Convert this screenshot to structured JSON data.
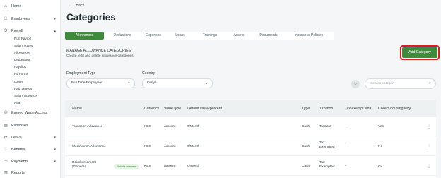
{
  "sidebar": {
    "top_items": [
      {
        "icon": "home-icon",
        "glyph": "⌂",
        "label": "Home"
      },
      {
        "icon": "employees-icon",
        "glyph": "⚇",
        "label": "Employees"
      },
      {
        "icon": "payroll-icon",
        "glyph": "$",
        "label": "Payroll"
      }
    ],
    "payroll_sub": [
      "Run Payroll",
      "Salary Rates",
      "Allowances",
      "Deductions",
      "Payslips",
      "P9 Forms",
      "Loans",
      "Paid Leaves",
      "Salary Advance",
      "Nita"
    ],
    "bottom_items": [
      {
        "icon": "earned-wage-icon",
        "glyph": "⛁",
        "label": "Earned Wage Access"
      },
      {
        "icon": "expenses-icon",
        "glyph": "▤",
        "label": "Expenses"
      },
      {
        "icon": "leave-icon",
        "glyph": "⇄",
        "label": "Leave"
      },
      {
        "icon": "benefits-icon",
        "glyph": "♡",
        "label": "Benefits"
      },
      {
        "icon": "payments-icon",
        "glyph": "▭",
        "label": "Payments"
      },
      {
        "icon": "reports-icon",
        "glyph": "▥",
        "label": "Reports"
      }
    ]
  },
  "header": {
    "back_label": "Back",
    "title": "Categories"
  },
  "tabs": [
    "Allowances",
    "Deductions",
    "Expenses",
    "Loans",
    "Trainings",
    "Assets",
    "Documents",
    "Insurance Policies"
  ],
  "active_tab": "Allowances",
  "section": {
    "title": "MANAGE ALLOWANCE CATEGORIES",
    "subtitle": "Create, edit and delete allowance categories"
  },
  "add_button": "Add Category",
  "filters": {
    "employment_label": "Employment Type",
    "employment_value": "Full Time Employees",
    "country_label": "Country",
    "country_value": "Kenya",
    "search_placeholder": "Search category"
  },
  "table": {
    "columns": [
      "Name",
      "Currency",
      "Value type",
      "Default value/percent",
      "Type",
      "Taxation",
      "Tax exempt limit",
      "Collect housing levy"
    ],
    "rows": [
      {
        "name": "Transport Allowance",
        "badge": "",
        "currency": "KES",
        "value_type": "Amount",
        "default": "0/Month",
        "type": "Cash",
        "taxation": "Taxable",
        "limit": "-",
        "housing": "Yes"
      },
      {
        "name": "Meal/Lunch Allowance",
        "badge": "",
        "currency": "KES",
        "value_type": "Amount",
        "default": "0/Month",
        "type": "Cash",
        "taxation": "Tax Exempted",
        "limit": "-",
        "housing": "No"
      },
      {
        "name": "Reimbursement (General)",
        "badge": "Reimbursement",
        "currency": "KES",
        "value_type": "Amount",
        "default": "0/Month",
        "type": "Cash",
        "taxation": "Tax Exempted",
        "limit": "-",
        "housing": "No"
      }
    ]
  },
  "colors": {
    "accent": "#3f8b3c",
    "highlight": "#e01b1b"
  }
}
